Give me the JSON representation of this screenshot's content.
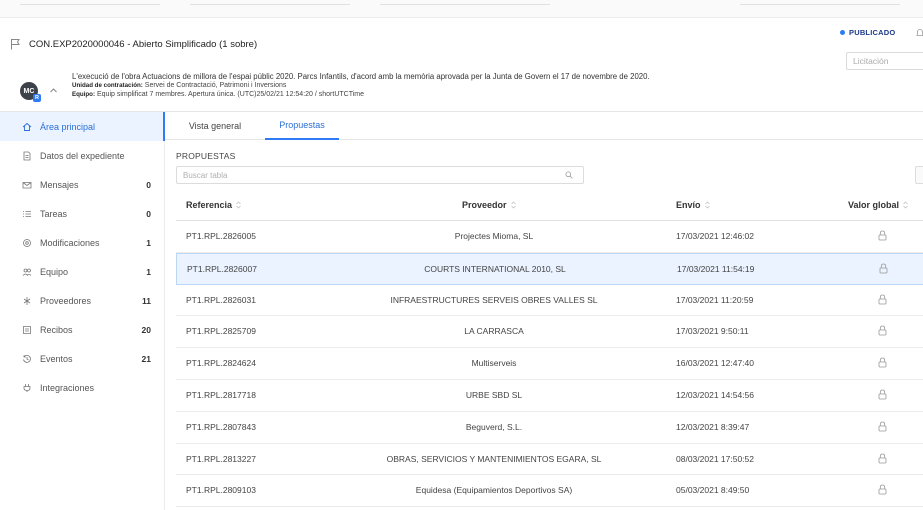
{
  "header": {
    "expedient_title": "CON.EXP2020000046 - Abierto Simplificado (1 sobre)",
    "status": "PUBLICADO",
    "phase_placeholder": "Licitación",
    "avatar_initials": "MC",
    "avatar_badge": "R",
    "description": "L'execució de l'obra Actuacions de millora de l'espai públic 2020. Parcs Infantils, d'acord amb la memòria aprovada per la Junta de Govern el 17 de novembre de 2020.",
    "unit_label": "Unidad de contratación:",
    "unit_value": "Servei de Contractació, Patrimoni i Inversions",
    "team_label": "Equipo:",
    "team_value": "Equip simplificat 7 membres. Apertura única. (UTC)25/02/21 12:54:20 / shortUTCTime"
  },
  "sidebar": {
    "items": [
      {
        "label": "Área principal",
        "count": "",
        "icon": "home-icon"
      },
      {
        "label": "Datos del expediente",
        "count": "",
        "icon": "document-icon"
      },
      {
        "label": "Mensajes",
        "count": "0",
        "icon": "mail-icon"
      },
      {
        "label": "Tareas",
        "count": "0",
        "icon": "task-list-icon"
      },
      {
        "label": "Modificaciones",
        "count": "1",
        "icon": "settings-icon"
      },
      {
        "label": "Equipo",
        "count": "1",
        "icon": "team-icon"
      },
      {
        "label": "Proveedores",
        "count": "11",
        "icon": "providers-icon"
      },
      {
        "label": "Recibos",
        "count": "20",
        "icon": "receipt-icon"
      },
      {
        "label": "Eventos",
        "count": "21",
        "icon": "history-icon"
      },
      {
        "label": "Integraciones",
        "count": "",
        "icon": "plug-icon"
      }
    ]
  },
  "tabs": [
    {
      "label": "Vista general"
    },
    {
      "label": "Propuestas"
    }
  ],
  "proposals": {
    "section_title": "PROPUESTAS",
    "search_placeholder": "Buscar tabla",
    "columns": {
      "reference": "Referencia",
      "provider": "Proveedor",
      "sent": "Envío",
      "global_value": "Valor global"
    },
    "rows": [
      {
        "reference": "PT1.RPL.2826005",
        "provider": "Projectes Mioma, SL",
        "sent": "17/03/2021 12:46:02"
      },
      {
        "reference": "PT1.RPL.2826007",
        "provider": "COURTS INTERNATIONAL 2010, SL",
        "sent": "17/03/2021 11:54:19"
      },
      {
        "reference": "PT1.RPL.2826031",
        "provider": "INFRAESTRUCTURES SERVEIS OBRES VALLES SL",
        "sent": "17/03/2021 11:20:59"
      },
      {
        "reference": "PT1.RPL.2825709",
        "provider": "LA CARRASCA",
        "sent": "17/03/2021 9:50:11"
      },
      {
        "reference": "PT1.RPL.2824624",
        "provider": "Multiserveis",
        "sent": "16/03/2021 12:47:40"
      },
      {
        "reference": "PT1.RPL.2817718",
        "provider": "URBE SBD SL",
        "sent": "12/03/2021 14:54:56"
      },
      {
        "reference": "PT1.RPL.2807843",
        "provider": "Beguverd, S.L.",
        "sent": "12/03/2021 8:39:47"
      },
      {
        "reference": "PT1.RPL.2813227",
        "provider": "OBRAS, SERVICIOS Y MANTENIMIENTOS EGARA, SL",
        "sent": "08/03/2021 17:50:52"
      },
      {
        "reference": "PT1.RPL.2809103",
        "provider": "Equidesa (Equipamientos Deportivos SA)",
        "sent": "05/03/2021 8:49:50"
      }
    ]
  },
  "colors": {
    "accent": "#2f7bf5",
    "active_bg": "#eaf3ff",
    "status_text": "#1e3a8a"
  }
}
